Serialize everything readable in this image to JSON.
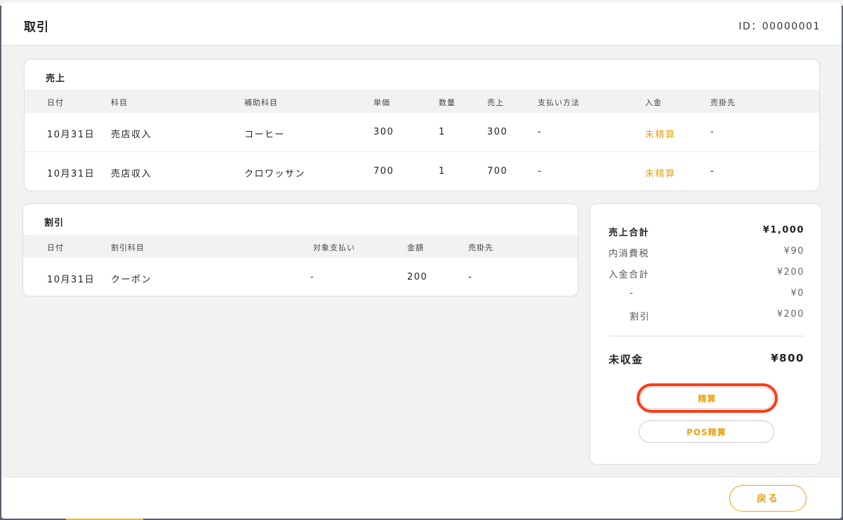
{
  "modal": {
    "title": "取引",
    "id_text": "ID：00000001"
  },
  "sales": {
    "title": "売上",
    "columns": [
      "日付",
      "科目",
      "補助科目",
      "単価",
      "数量",
      "売上",
      "支払い方法",
      "入金",
      "売掛先"
    ],
    "rows": [
      [
        "10月31日",
        "売店収入",
        "コーヒー",
        "300",
        "1",
        "300",
        "-",
        "未精算",
        "-"
      ],
      [
        "10月31日",
        "売店収入",
        "クロワッサン",
        "700",
        "1",
        "700",
        "-",
        "未精算",
        "-"
      ]
    ]
  },
  "discount": {
    "title": "割引",
    "columns": [
      "日付",
      "割引科目",
      "対象支払い",
      "金額",
      "売掛先"
    ],
    "rows": [
      [
        "10月31日",
        "クーポン",
        "-",
        "200",
        "-"
      ]
    ]
  },
  "summary": {
    "sales_total_label": "売上合計",
    "sales_total_value": "¥1,000",
    "tax_label": "内消費税",
    "tax_value": "¥90",
    "paid_total_label": "入金合計",
    "paid_total_value": "¥200",
    "sub1_label": "-",
    "sub1_value": "¥0",
    "sub2_label": "割引",
    "sub2_value": "¥200",
    "unpaid_label": "未収金",
    "unpaid_value": "¥800",
    "settle_button": "精算",
    "pos_settle_button": "POS精算"
  },
  "footer": {
    "back_button": "戻る"
  },
  "colors": {
    "accent": "#e8a317",
    "highlight": "#ff3a14"
  }
}
